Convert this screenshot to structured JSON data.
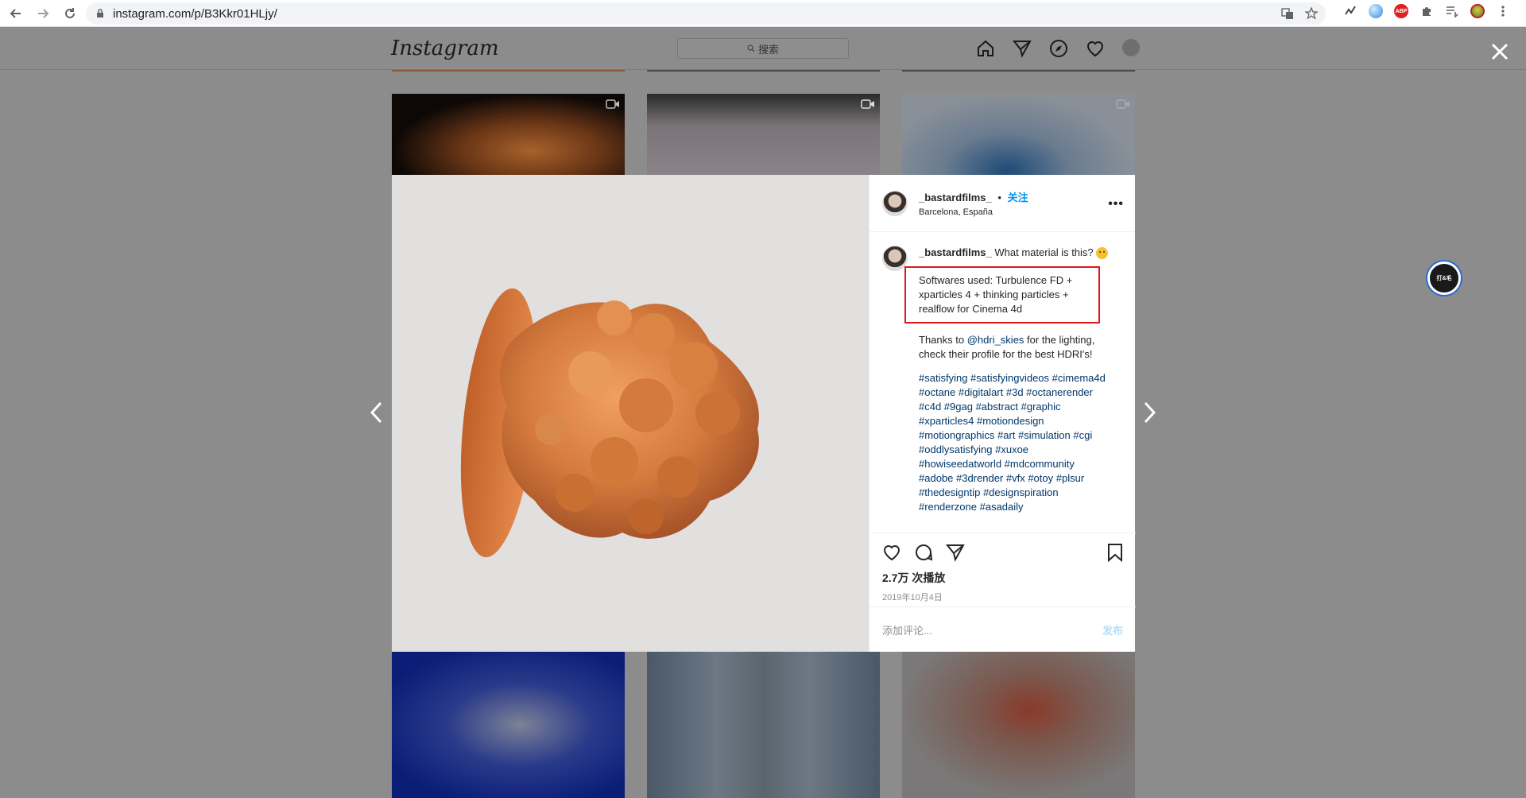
{
  "browser": {
    "url": "instagram.com/p/B3Kkr01HLjy/"
  },
  "header": {
    "logo": "Instagram",
    "search_placeholder": "搜索"
  },
  "post": {
    "username": "_bastardfilms_",
    "separator": "•",
    "follow_label": "关注",
    "location": "Barcelona, España",
    "more_label": "•••",
    "caption_question": "What material is this?",
    "softwares": "Softwares used: Turbulence FD + xparticles 4 + thinking particles + realflow for Cinema 4d",
    "thanks_prefix": "Thanks to ",
    "thanks_mention": "@hdri_skies",
    "thanks_suffix": " for the lighting, check their profile for the best HDRI's!",
    "hashtags": "#satisfying #satisfyingvideos #cimema4d #octane #digitalart #3d #octanerender #c4d #9gag #abstract #graphic #xparticles4 #motiondesign #motiongraphics #art #simulation #cgi #oddlysatisfying #xuxoe #howiseedatworld #mdcommunity #adobe #3drender #vfx #otoy #plsur #thedesigntip #designspiration #renderzone #asadaily",
    "views": "2.7万 次播放",
    "date": "2019年10月4日",
    "comment_placeholder": "添加评论...",
    "post_button": "发布"
  },
  "badge": {
    "label": "打&毛"
  },
  "colors": {
    "follow_blue": "#0095f6",
    "highlight_red": "#e0161c",
    "overlay": "#8c8c8c"
  }
}
